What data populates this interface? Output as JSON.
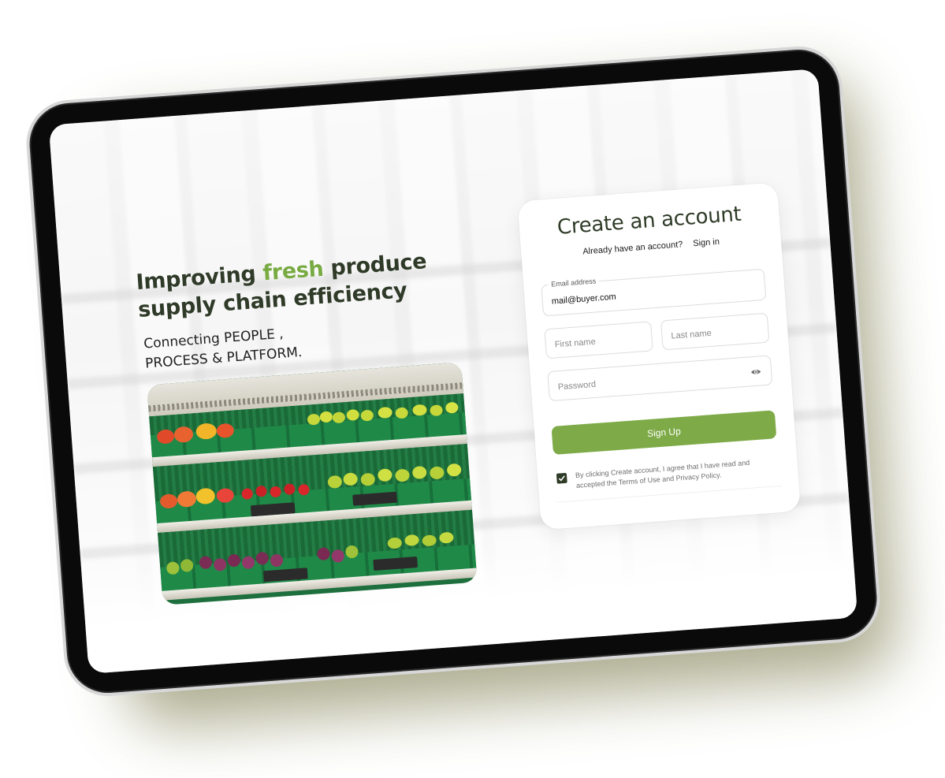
{
  "hero": {
    "title_part1": "Improving ",
    "title_accent": "fresh",
    "title_part2": " produce supply chain efficiency",
    "subtitle": "Connecting PEOPLE , PROCESS & PLATFORM."
  },
  "signup": {
    "title": "Create an account",
    "have_account_text": "Already have an account?",
    "signin_link": "Sign in",
    "email": {
      "label": "Email address",
      "value": "mail@buyer.com"
    },
    "first_name": {
      "placeholder": "First name"
    },
    "last_name": {
      "placeholder": "Last name"
    },
    "password": {
      "placeholder": "Password",
      "toggle_icon": "eye-icon"
    },
    "submit_label": "Sign Up",
    "consent": {
      "checked": true,
      "text": "By clicking Create account, I agree that I have read and accepted the Terms of Use and Privacy Policy."
    }
  },
  "colors": {
    "accent": "#79ab43",
    "button": "#7eab48",
    "heading": "#2e3b27"
  }
}
